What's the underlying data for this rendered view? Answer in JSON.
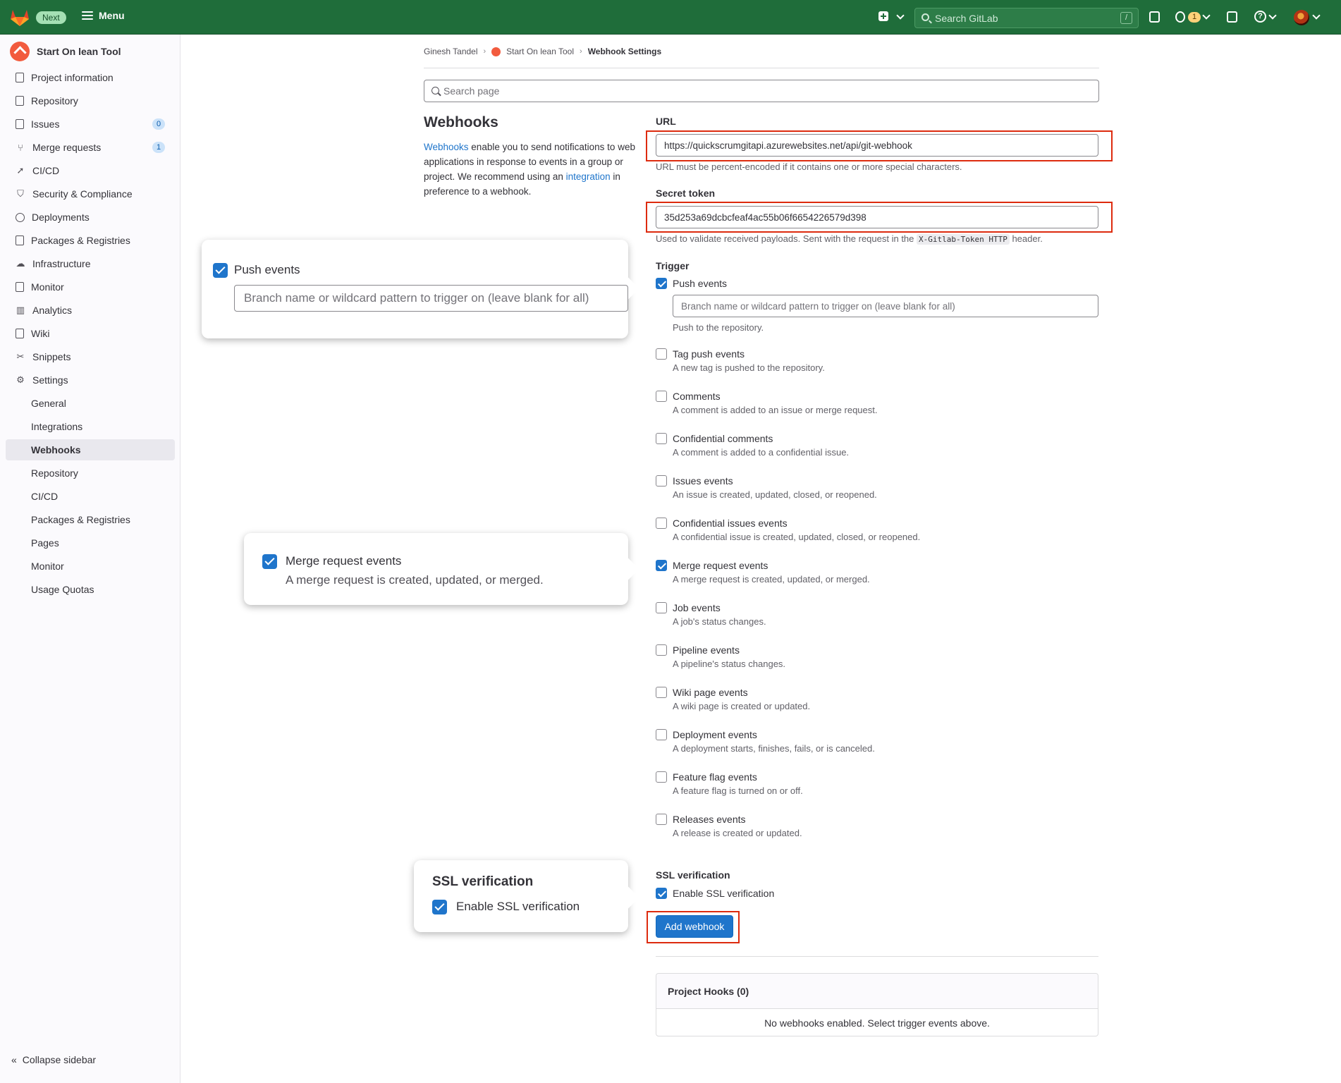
{
  "topbar": {
    "next_badge": "Next",
    "menu_label": "Menu",
    "search_placeholder": "Search GitLab",
    "search_shortcut": "/",
    "merge_requests_count": "1",
    "help_glyph": "?"
  },
  "sidebar": {
    "project_name": "Start On lean Tool",
    "items": [
      {
        "label": "Project information",
        "icon": "info-icon"
      },
      {
        "label": "Repository",
        "icon": "doc-icon"
      },
      {
        "label": "Issues",
        "icon": "issues-icon",
        "count": "0"
      },
      {
        "label": "Merge requests",
        "icon": "merge-request-icon",
        "count": "1"
      },
      {
        "label": "CI/CD",
        "icon": "rocket-icon"
      },
      {
        "label": "Security & Compliance",
        "icon": "shield-icon"
      },
      {
        "label": "Deployments",
        "icon": "deployments-icon"
      },
      {
        "label": "Packages & Registries",
        "icon": "package-icon"
      },
      {
        "label": "Infrastructure",
        "icon": "cloud-icon"
      },
      {
        "label": "Monitor",
        "icon": "monitor-icon"
      },
      {
        "label": "Analytics",
        "icon": "chart-icon"
      },
      {
        "label": "Wiki",
        "icon": "book-icon"
      },
      {
        "label": "Snippets",
        "icon": "scissors-icon"
      },
      {
        "label": "Settings",
        "icon": "gear-icon"
      }
    ],
    "settings_sub": [
      "General",
      "Integrations",
      "Webhooks",
      "Repository",
      "CI/CD",
      "Packages & Registries",
      "Pages",
      "Monitor",
      "Usage Quotas"
    ],
    "collapse_label": "Collapse sidebar"
  },
  "breadcrumb": {
    "user": "Ginesh Tandel",
    "project": "Start On lean Tool",
    "current": "Webhook Settings"
  },
  "search_page_placeholder": "Search page",
  "webhooks": {
    "title": "Webhooks",
    "desc_link1": "Webhooks",
    "desc_part1": " enable you to send notifications to web applications in response to events in a group or project. We recommend using an ",
    "desc_link2": "integration",
    "desc_part2": " in preference to a webhook."
  },
  "form": {
    "url_label": "URL",
    "url_value": "https://quickscrumgitapi.azurewebsites.net/api/git-webhook",
    "url_help": "URL must be percent-encoded if it contains one or more special characters.",
    "token_label": "Secret token",
    "token_value": "35d253a69dcbcfeaf4ac55b06f6654226579d398",
    "token_help_pre": "Used to validate received payloads. Sent with the request in the ",
    "token_help_code": "X-Gitlab-Token HTTP",
    "token_help_post": " header.",
    "trigger_label": "Trigger",
    "branch_placeholder": "Branch name or wildcard pattern to trigger on (leave blank for all)",
    "triggers": [
      {
        "label": "Push events",
        "help": "Push to the repository.",
        "checked": true
      },
      {
        "label": "Tag push events",
        "help": "A new tag is pushed to the repository.",
        "checked": false
      },
      {
        "label": "Comments",
        "help": "A comment is added to an issue or merge request.",
        "checked": false
      },
      {
        "label": "Confidential comments",
        "help": "A comment is added to a confidential issue.",
        "checked": false
      },
      {
        "label": "Issues events",
        "help": "An issue is created, updated, closed, or reopened.",
        "checked": false
      },
      {
        "label": "Confidential issues events",
        "help": "A confidential issue is created, updated, closed, or reopened.",
        "checked": false
      },
      {
        "label": "Merge request events",
        "help": "A merge request is created, updated, or merged.",
        "checked": true
      },
      {
        "label": "Job events",
        "help": "A job's status changes.",
        "checked": false
      },
      {
        "label": "Pipeline events",
        "help": "A pipeline's status changes.",
        "checked": false
      },
      {
        "label": "Wiki page events",
        "help": "A wiki page is created or updated.",
        "checked": false
      },
      {
        "label": "Deployment events",
        "help": "A deployment starts, finishes, fails, or is canceled.",
        "checked": false
      },
      {
        "label": "Feature flag events",
        "help": "A feature flag is turned on or off.",
        "checked": false
      },
      {
        "label": "Releases events",
        "help": "A release is created or updated.",
        "checked": false
      }
    ],
    "ssl_label": "SSL verification",
    "ssl_checkbox": "Enable SSL verification",
    "add_button": "Add webhook"
  },
  "project_hooks": {
    "title": "Project Hooks (0)",
    "empty": "No webhooks enabled. Select trigger events above."
  },
  "callouts": {
    "push_label": "Push events",
    "push_placeholder": "Branch name or wildcard pattern to trigger on (leave blank for all)",
    "merge_label": "Merge request events",
    "merge_help": "A merge request is created, updated, or merged.",
    "ssl_title": "SSL verification",
    "ssl_label": "Enable SSL verification"
  },
  "colors": {
    "topbar": "#1f6d3a",
    "accent": "#1f75cb",
    "highlight_box": "#dd2b0e"
  }
}
